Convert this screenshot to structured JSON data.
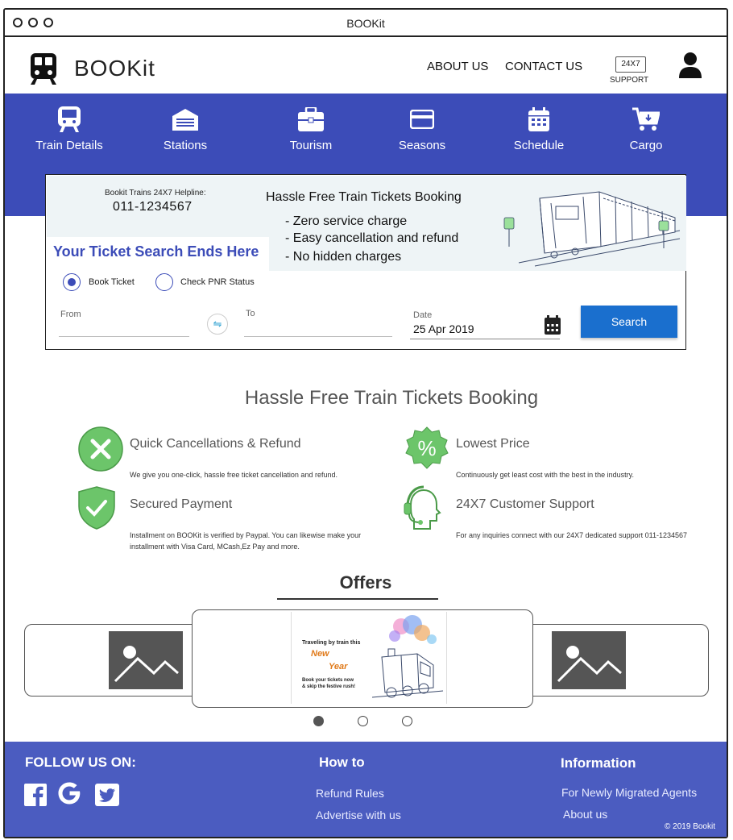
{
  "window": {
    "title": "BOOKit"
  },
  "header": {
    "brand": "BOOKit",
    "nav": [
      "ABOUT US",
      "CONTACT US"
    ],
    "support_badge": "24X7",
    "support_label": "SUPPORT"
  },
  "navbar": {
    "items": [
      {
        "label": "Train Details",
        "icon": "train-icon"
      },
      {
        "label": "Stations",
        "icon": "station-icon"
      },
      {
        "label": "Tourism",
        "icon": "briefcase-icon"
      },
      {
        "label": "Seasons",
        "icon": "card-icon"
      },
      {
        "label": "Schedule",
        "icon": "calendar-icon"
      },
      {
        "label": "Cargo",
        "icon": "cart-icon"
      }
    ]
  },
  "search_card": {
    "helpline_title": "Bookit Trains 24X7 Helpline:",
    "helpline_number": "011-1234567",
    "banner_title": "Hassle Free Train Tickets Booking",
    "banner_points": [
      "- Zero service charge",
      "- Easy cancellation and refund",
      "- No hidden charges"
    ],
    "tagline": "Your Ticket Search Ends Here",
    "radio_options": [
      {
        "label": "Book Ticket",
        "selected": true
      },
      {
        "label": "Check PNR Status",
        "selected": false
      }
    ],
    "from_label": "From",
    "from_value": "",
    "to_label": "To",
    "to_value": "",
    "date_label": "Date",
    "date_value": "25 Apr 2019",
    "search_button": "Search"
  },
  "features": {
    "title": "Hassle Free Train Tickets Booking",
    "items": [
      {
        "title": "Quick Cancellations & Refund",
        "desc": "We give you one-click, hassle free ticket cancellation and refund.",
        "icon": "cancel-icon"
      },
      {
        "title": "Lowest Price",
        "desc": "Continuously get least cost with the best in the industry.",
        "icon": "percent-badge-icon"
      },
      {
        "title": "Secured Payment",
        "desc": "Installment on BOOKit is verified by Paypal. You can likewise make your installment with Visa Card, MCash,Ez Pay and more.",
        "icon": "shield-check-icon"
      },
      {
        "title": "24X7 Customer Support",
        "desc": "For any inquiries connect with our 24X7 dedicated support 011-1234567",
        "icon": "headset-icon"
      }
    ]
  },
  "offers": {
    "title": "Offers",
    "promo_line1": "Traveling by train this",
    "promo_new": "New",
    "promo_year": "Year",
    "promo_line2": "Book your tickets now",
    "promo_line3": "& skip the festive rush!",
    "active_slide": 1,
    "slide_count": 3
  },
  "footer": {
    "follow_title": "FOLLOW US ON:",
    "howto_title": "How to",
    "howto_links": [
      "Refund Rules",
      "Advertise with us"
    ],
    "info_title": "Information",
    "info_links": [
      "For Newly Migrated Agents",
      "About us"
    ],
    "copyright": "© 2019 Bookit"
  },
  "colors": {
    "primary": "#3c4cb8",
    "footer": "#4b5cc0",
    "button": "#1a6fce",
    "feature_green": "#6cc56a"
  }
}
